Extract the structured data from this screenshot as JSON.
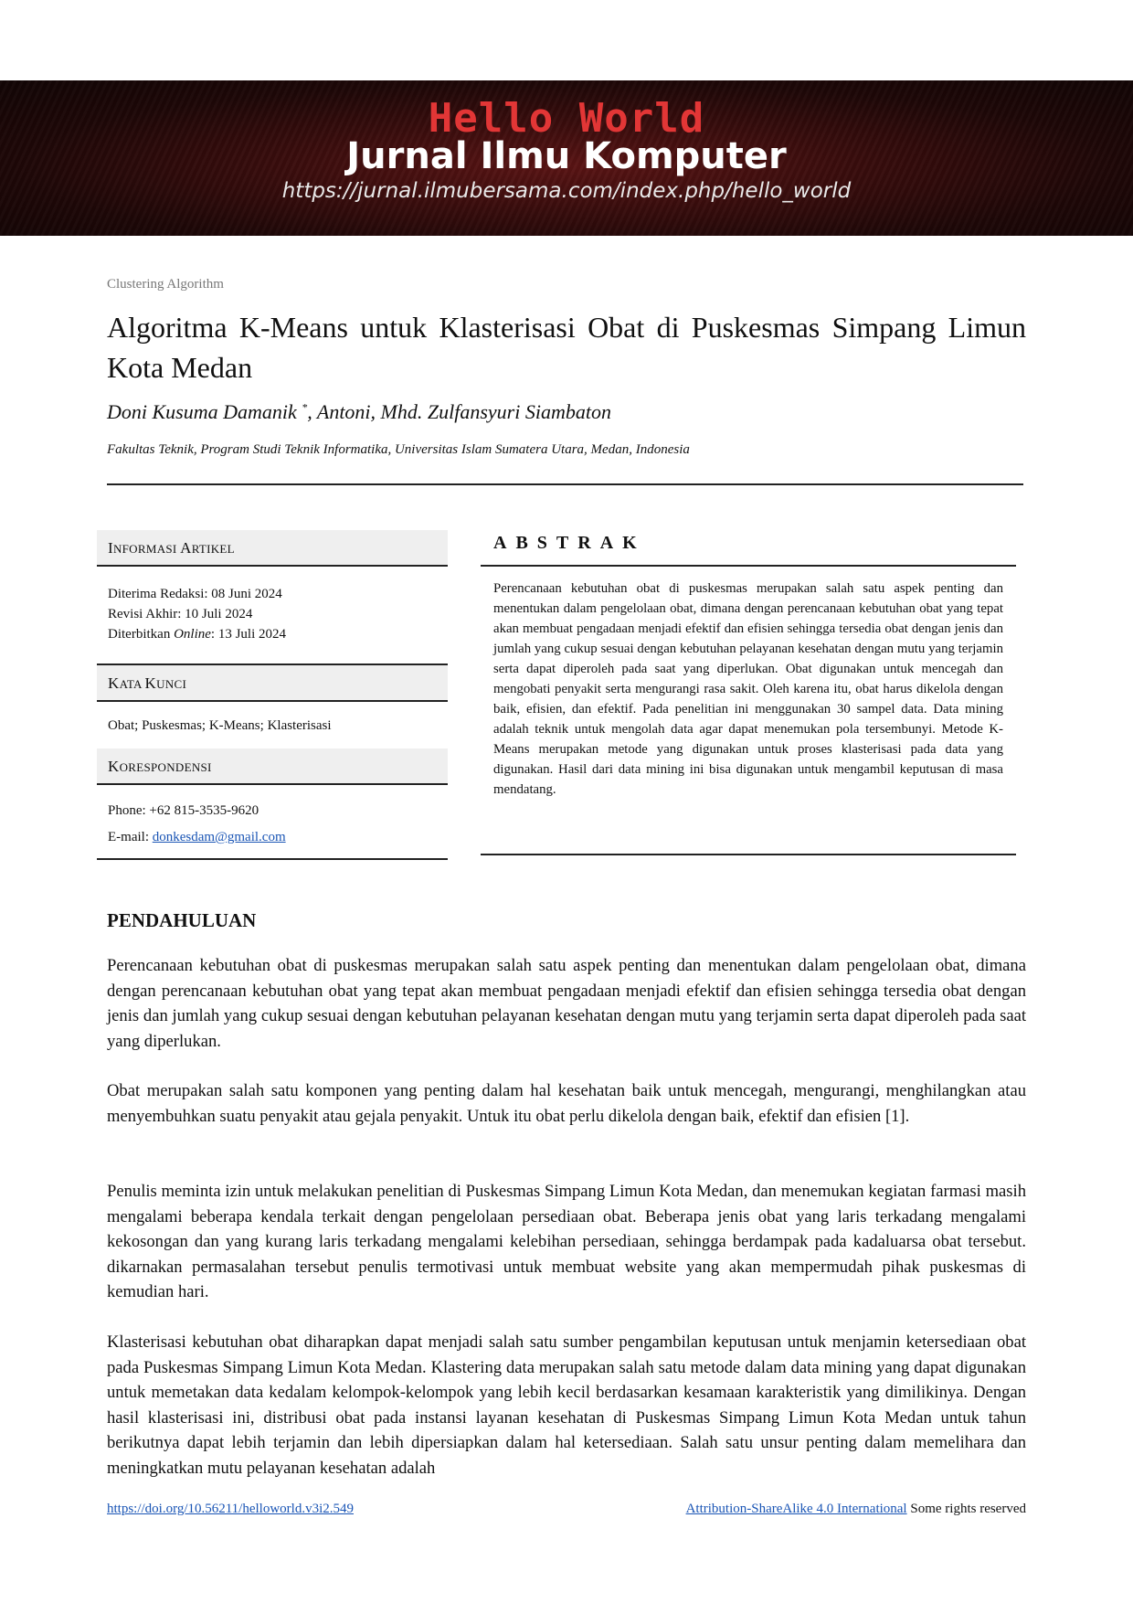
{
  "banner": {
    "hello": "Hello World",
    "title": "Jurnal Ilmu Komputer",
    "url": "https://jurnal.ilmubersama.com/index.php/hello_world"
  },
  "category": "Clustering Algorithm",
  "title": "Algoritma K-Means untuk Klasterisasi Obat di Puskesmas Simpang Limun Kota Medan",
  "authors": {
    "first": "Doni Kusuma Damanik",
    "mark": "*",
    "rest": ", Antoni, Mhd. Zulfansyuri Siambaton"
  },
  "affiliation": "Fakultas Teknik, Program Studi Teknik Informatika, Universitas Islam Sumatera Utara, Medan, Indonesia",
  "info": {
    "article_head": {
      "cap1": "I",
      "rest1": "NFORMASI ",
      "cap2": "A",
      "rest2": "RTIKEL"
    },
    "received": "Diterima Redaksi: 08 Juni 2024",
    "revised": "Revisi Akhir: 10 Juli 2024",
    "published_prefix": "Diterbitkan ",
    "published_italic": "Online",
    "published_suffix": ": 13 Juli 2024",
    "keywords_head": {
      "cap1": "K",
      "rest1": "ATA ",
      "cap2": "K",
      "rest2": "UNCI"
    },
    "keywords": "Obat; Puskesmas; K-Means; Klasterisasi",
    "corr_head": {
      "cap1": "K",
      "rest1": "ORESPONDENSI"
    },
    "phone": "Phone: +62 815-3535-9620",
    "email_label": "E-mail: ",
    "email": "donkesdam@gmail.com"
  },
  "abstract": {
    "heading": "ABSTRAK",
    "text": "Perencanaan kebutuhan obat di puskesmas merupakan salah satu aspek penting dan menentukan dalam pengelolaan obat, dimana dengan perencanaan kebutuhan obat yang tepat akan membuat pengadaan menjadi efektif dan efisien sehingga tersedia obat dengan jenis dan jumlah yang cukup sesuai dengan kebutuhan pelayanan kesehatan dengan mutu yang terjamin serta dapat diperoleh pada saat yang diperlukan. Obat digunakan untuk mencegah dan mengobati penyakit serta mengurangi rasa sakit. Oleh karena itu, obat harus dikelola dengan baik, efisien, dan efektif. Pada penelitian ini menggunakan 30 sampel data. Data mining adalah teknik untuk mengolah data agar dapat menemukan pola tersembunyi. Metode K-Means merupakan metode yang digunakan untuk proses klasterisasi pada data yang digunakan. Hasil dari data mining ini bisa digunakan untuk mengambil keputusan di masa mendatang."
  },
  "intro": {
    "heading": "PENDAHULUAN",
    "p1": "Perencanaan kebutuhan obat di puskesmas merupakan salah satu aspek penting dan menentukan dalam pengelolaan obat, dimana dengan perencanaan kebutuhan obat yang tepat akan membuat pengadaan menjadi efektif dan efisien sehingga tersedia obat dengan jenis dan jumlah yang cukup sesuai dengan kebutuhan pelayanan kesehatan dengan mutu yang terjamin serta dapat diperoleh pada saat yang diperlukan.",
    "p2": "Obat merupakan salah satu komponen yang penting dalam hal kesehatan baik untuk mencegah, mengurangi, menghilangkan atau menyembuhkan suatu penyakit atau gejala penyakit. Untuk itu obat perlu dikelola dengan baik, efektif dan efisien [1].",
    "p3": "Penulis meminta izin untuk melakukan penelitian di Puskesmas Simpang Limun Kota Medan, dan menemukan kegiatan farmasi masih mengalami beberapa kendala terkait dengan pengelolaan persediaan obat. Beberapa jenis obat yang laris terkadang mengalami kekosongan dan yang kurang laris terkadang mengalami kelebihan persediaan, sehingga berdampak pada kadaluarsa obat tersebut. dikarnakan permasalahan tersebut penulis termotivasi untuk membuat website yang akan mempermudah pihak puskesmas di kemudian hari.",
    "p4": "Klasterisasi kebutuhan obat diharapkan dapat menjadi salah satu sumber pengambilan keputusan untuk menjamin ketersediaan obat pada Puskesmas Simpang Limun Kota Medan. Klastering data merupakan salah satu metode dalam data mining yang dapat digunakan untuk memetakan data kedalam kelompok-kelompok yang lebih kecil berdasarkan kesamaan karakteristik yang dimilikinya. Dengan hasil klasterisasi ini, distribusi obat pada instansi layanan kesehatan di Puskesmas Simpang Limun Kota Medan untuk tahun berikutnya dapat lebih terjamin dan lebih dipersiapkan dalam hal ketersediaan. Salah satu unsur penting dalam memelihara dan meningkatkan mutu pelayanan kesehatan adalah"
  },
  "footer": {
    "doi": "https://doi.org/10.56211/helloworld.v3i2.549",
    "license": "Attribution-ShareAlike 4.0 International",
    "rights": " Some rights reserved"
  }
}
